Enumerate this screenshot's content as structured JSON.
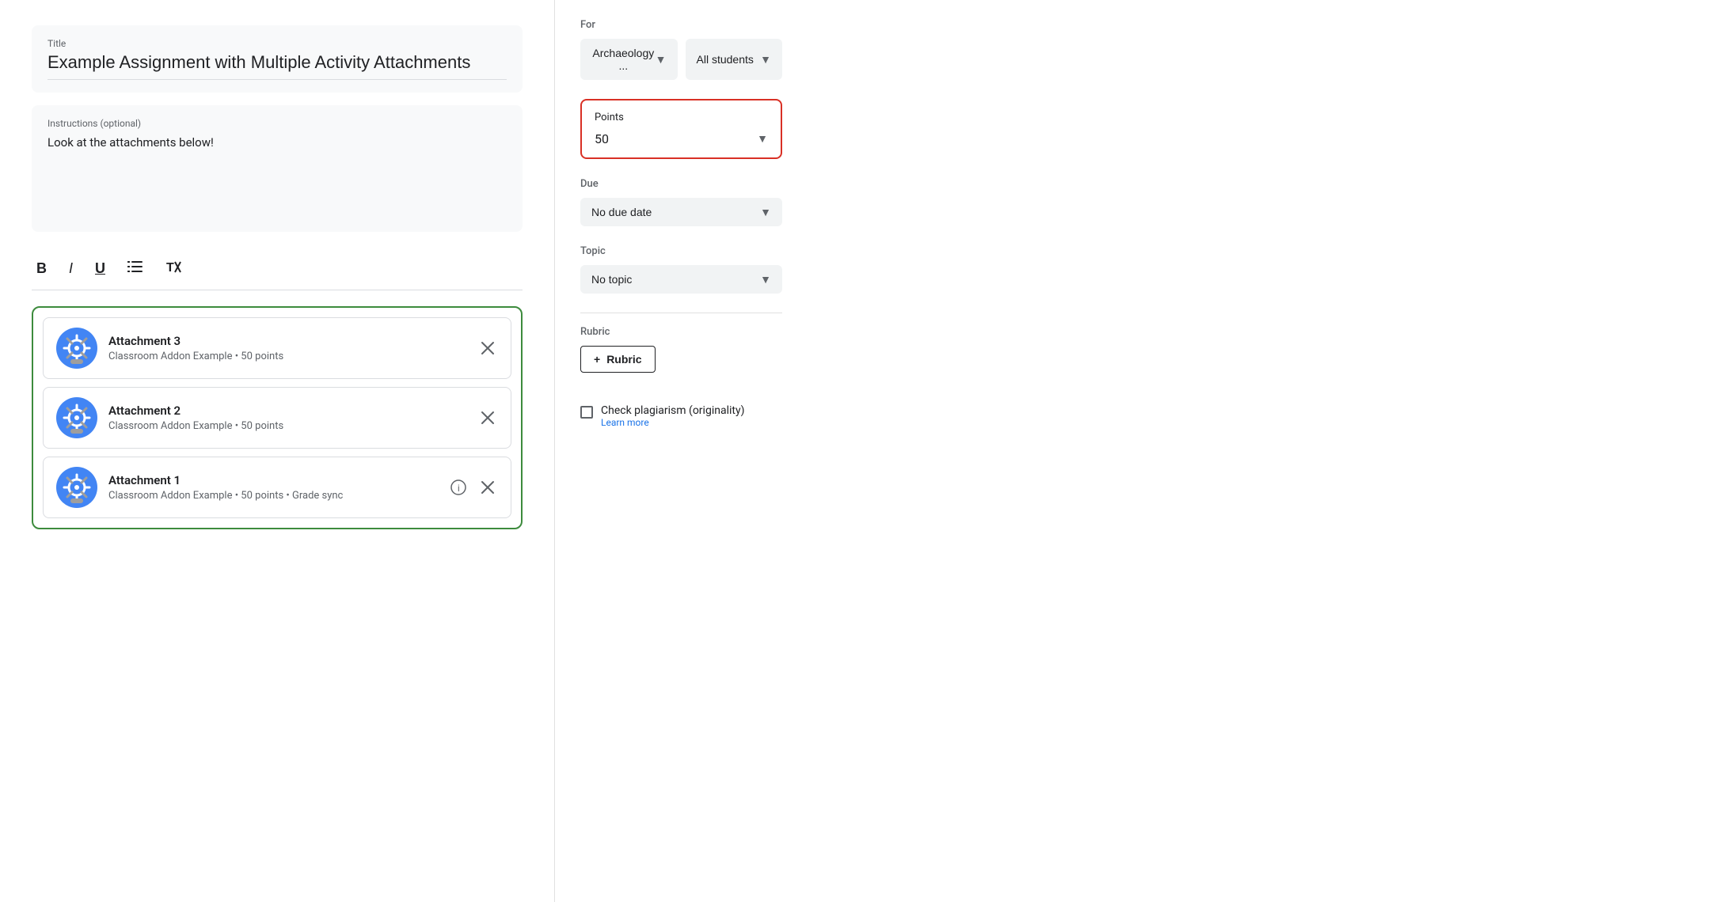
{
  "main": {
    "title_label": "Title",
    "title_value": "Example Assignment with Multiple Activity Attachments",
    "instructions_label": "Instructions (optional)",
    "instructions_value": "Look at the attachments below!",
    "toolbar": {
      "bold": "B",
      "italic": "I",
      "underline": "U",
      "list": "≡",
      "clear": "✕"
    },
    "attachments": [
      {
        "name": "Attachment 3",
        "meta": "Classroom Addon Example • 50 points",
        "has_info": false
      },
      {
        "name": "Attachment 2",
        "meta": "Classroom Addon Example • 50 points",
        "has_info": false
      },
      {
        "name": "Attachment 1",
        "meta": "Classroom Addon Example • 50 points • Grade sync",
        "has_info": true
      }
    ]
  },
  "sidebar": {
    "for_label": "For",
    "class_value": "Archaeology ...",
    "students_value": "All students",
    "points_label": "Points",
    "points_value": "50",
    "due_label": "Due",
    "due_value": "No due date",
    "topic_label": "Topic",
    "topic_value": "No topic",
    "rubric_label": "Rubric",
    "rubric_btn": "Rubric",
    "rubric_plus": "+",
    "plagiarism_title": "Check plagiarism (originality)",
    "plagiarism_link": "Learn more"
  }
}
